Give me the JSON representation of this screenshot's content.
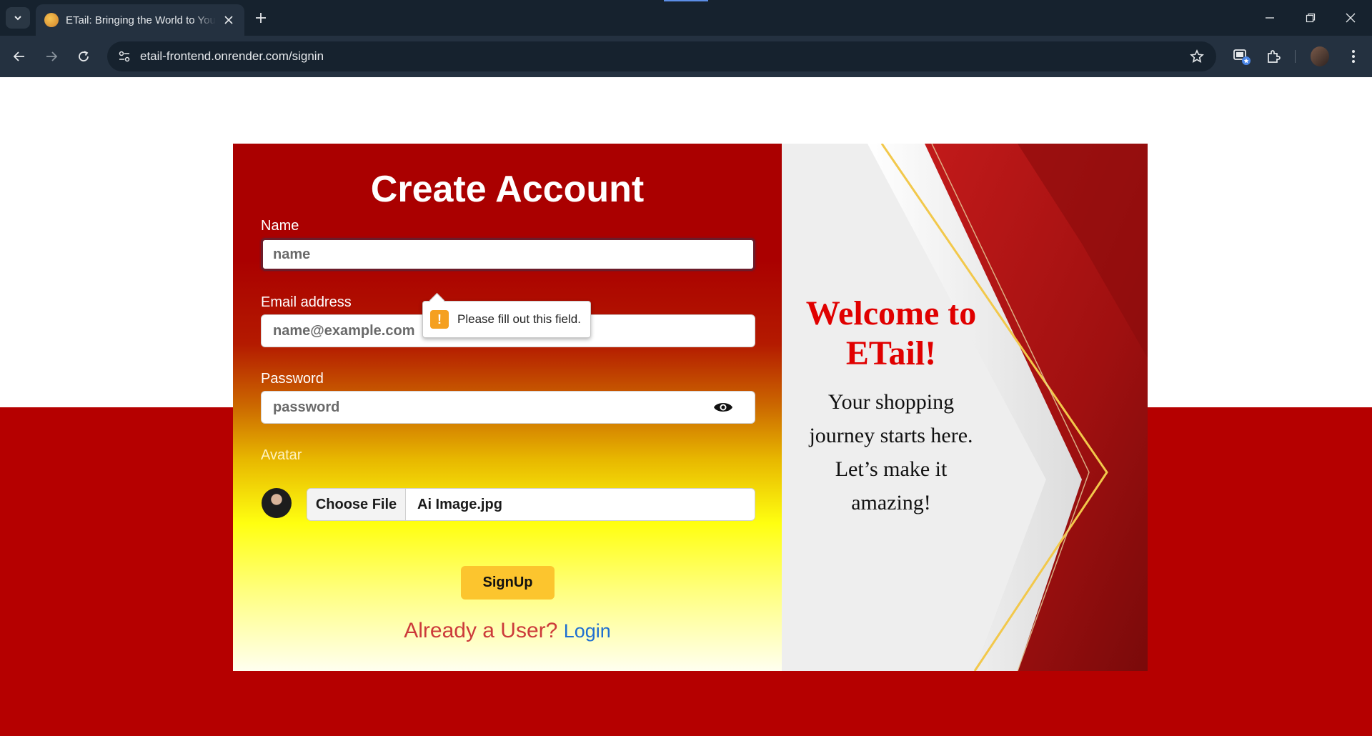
{
  "browser": {
    "tab_title": "ETail: Bringing the World to You",
    "url": "etail-frontend.onrender.com/signin"
  },
  "form": {
    "title": "Create Account",
    "name_label": "Name",
    "name_placeholder": "name",
    "email_label": "Email address",
    "email_placeholder": "name@example.com",
    "password_label": "Password",
    "password_placeholder": "password",
    "avatar_label": "Avatar",
    "choose_file_label": "Choose File",
    "file_name": "Ai Image.jpg",
    "signup_label": "SignUp",
    "already_user_text": "Already a User?",
    "login_link": "Login"
  },
  "validation": {
    "message": "Please fill out this field.",
    "icon": "!"
  },
  "welcome": {
    "title": "Welcome to ETail!",
    "text": "Your shopping journey starts here. Let’s make it amazing!"
  },
  "colors": {
    "accent_red": "#aa0000",
    "page_red": "#b50000",
    "signup_yellow": "#fcc52e",
    "welcome_red": "#e00000",
    "link_blue": "#1f6fd1"
  }
}
